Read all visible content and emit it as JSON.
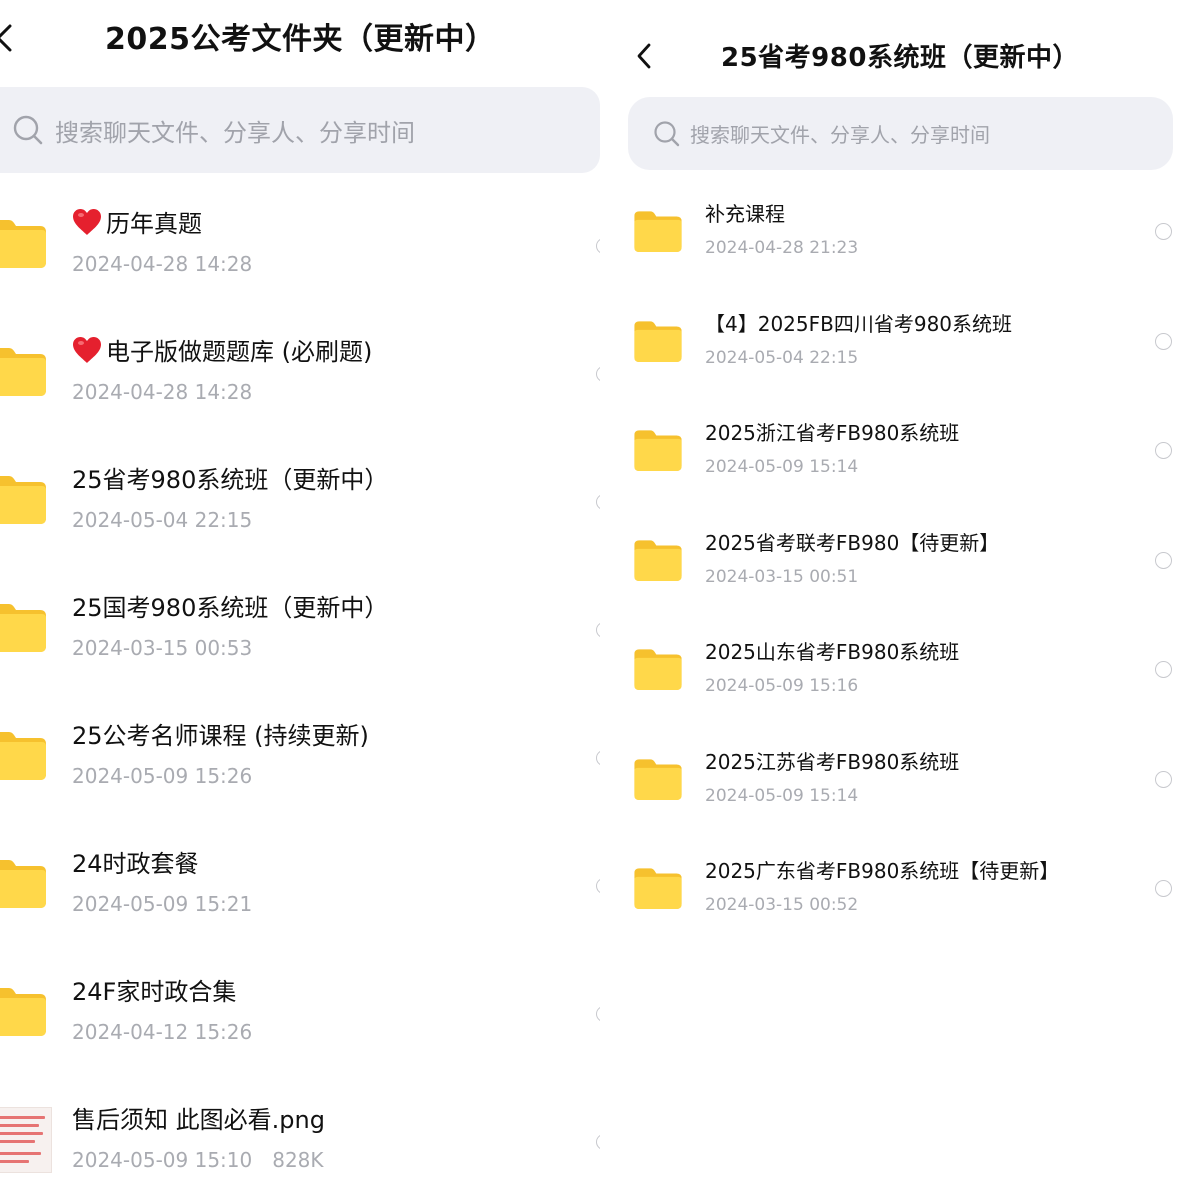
{
  "left_panel": {
    "title": "2025公考文件夹（更新中）",
    "search_placeholder": "搜索聊天文件、分享人、分享时间",
    "files": [
      {
        "name": "历年真题",
        "date": "2024-04-28 14:28",
        "heart": true
      },
      {
        "name": "电子版做题题库 (必刷题)",
        "date": "2024-04-28 14:28",
        "heart": true
      },
      {
        "name": "25省考980系统班（更新中）",
        "date": "2024-05-04 22:15"
      },
      {
        "name": "25国考980系统班（更新中）",
        "date": "2024-03-15 00:53"
      },
      {
        "name": "25公考名师课程 (持续更新)",
        "date": "2024-05-09 15:26"
      },
      {
        "name": "24时政套餐",
        "date": "2024-05-09 15:21"
      },
      {
        "name": "24F家时政合集",
        "date": "2024-04-12 15:26"
      },
      {
        "name": "售后须知 此图必看.png",
        "date": "2024-05-09 15:10",
        "size": "828K",
        "type": "image"
      }
    ]
  },
  "right_panel": {
    "title": "25省考980系统班（更新中）",
    "search_placeholder": "搜索聊天文件、分享人、分享时间",
    "files": [
      {
        "name": "补充课程",
        "date": "2024-04-28 21:23"
      },
      {
        "name": "【4】2025FB四川省考980系统班",
        "date": "2024-05-04 22:15"
      },
      {
        "name": "2025浙江省考FB980系统班",
        "date": "2024-05-09 15:14"
      },
      {
        "name": "2025省考联考FB980【待更新】",
        "date": "2024-03-15 00:51"
      },
      {
        "name": "2025山东省考FB980系统班",
        "date": "2024-05-09 15:16"
      },
      {
        "name": "2025江苏省考FB980系统班",
        "date": "2024-05-09 15:14"
      },
      {
        "name": "2025广东省考FB980系统班【待更新】",
        "date": "2024-03-15 00:52"
      }
    ]
  },
  "icons": {
    "back": "chevron-left-icon",
    "search": "search-icon",
    "folder": "folder-icon",
    "heart": "heart-icon",
    "image_file": "image-thumbnail-icon",
    "select": "radio-circle-icon"
  },
  "colors": {
    "folder_back": "#f7c531",
    "folder_front": "#ffd84a",
    "search_bg": "#eff0f5",
    "meta_text": "#a9abb1",
    "heart": "#e5202e"
  }
}
